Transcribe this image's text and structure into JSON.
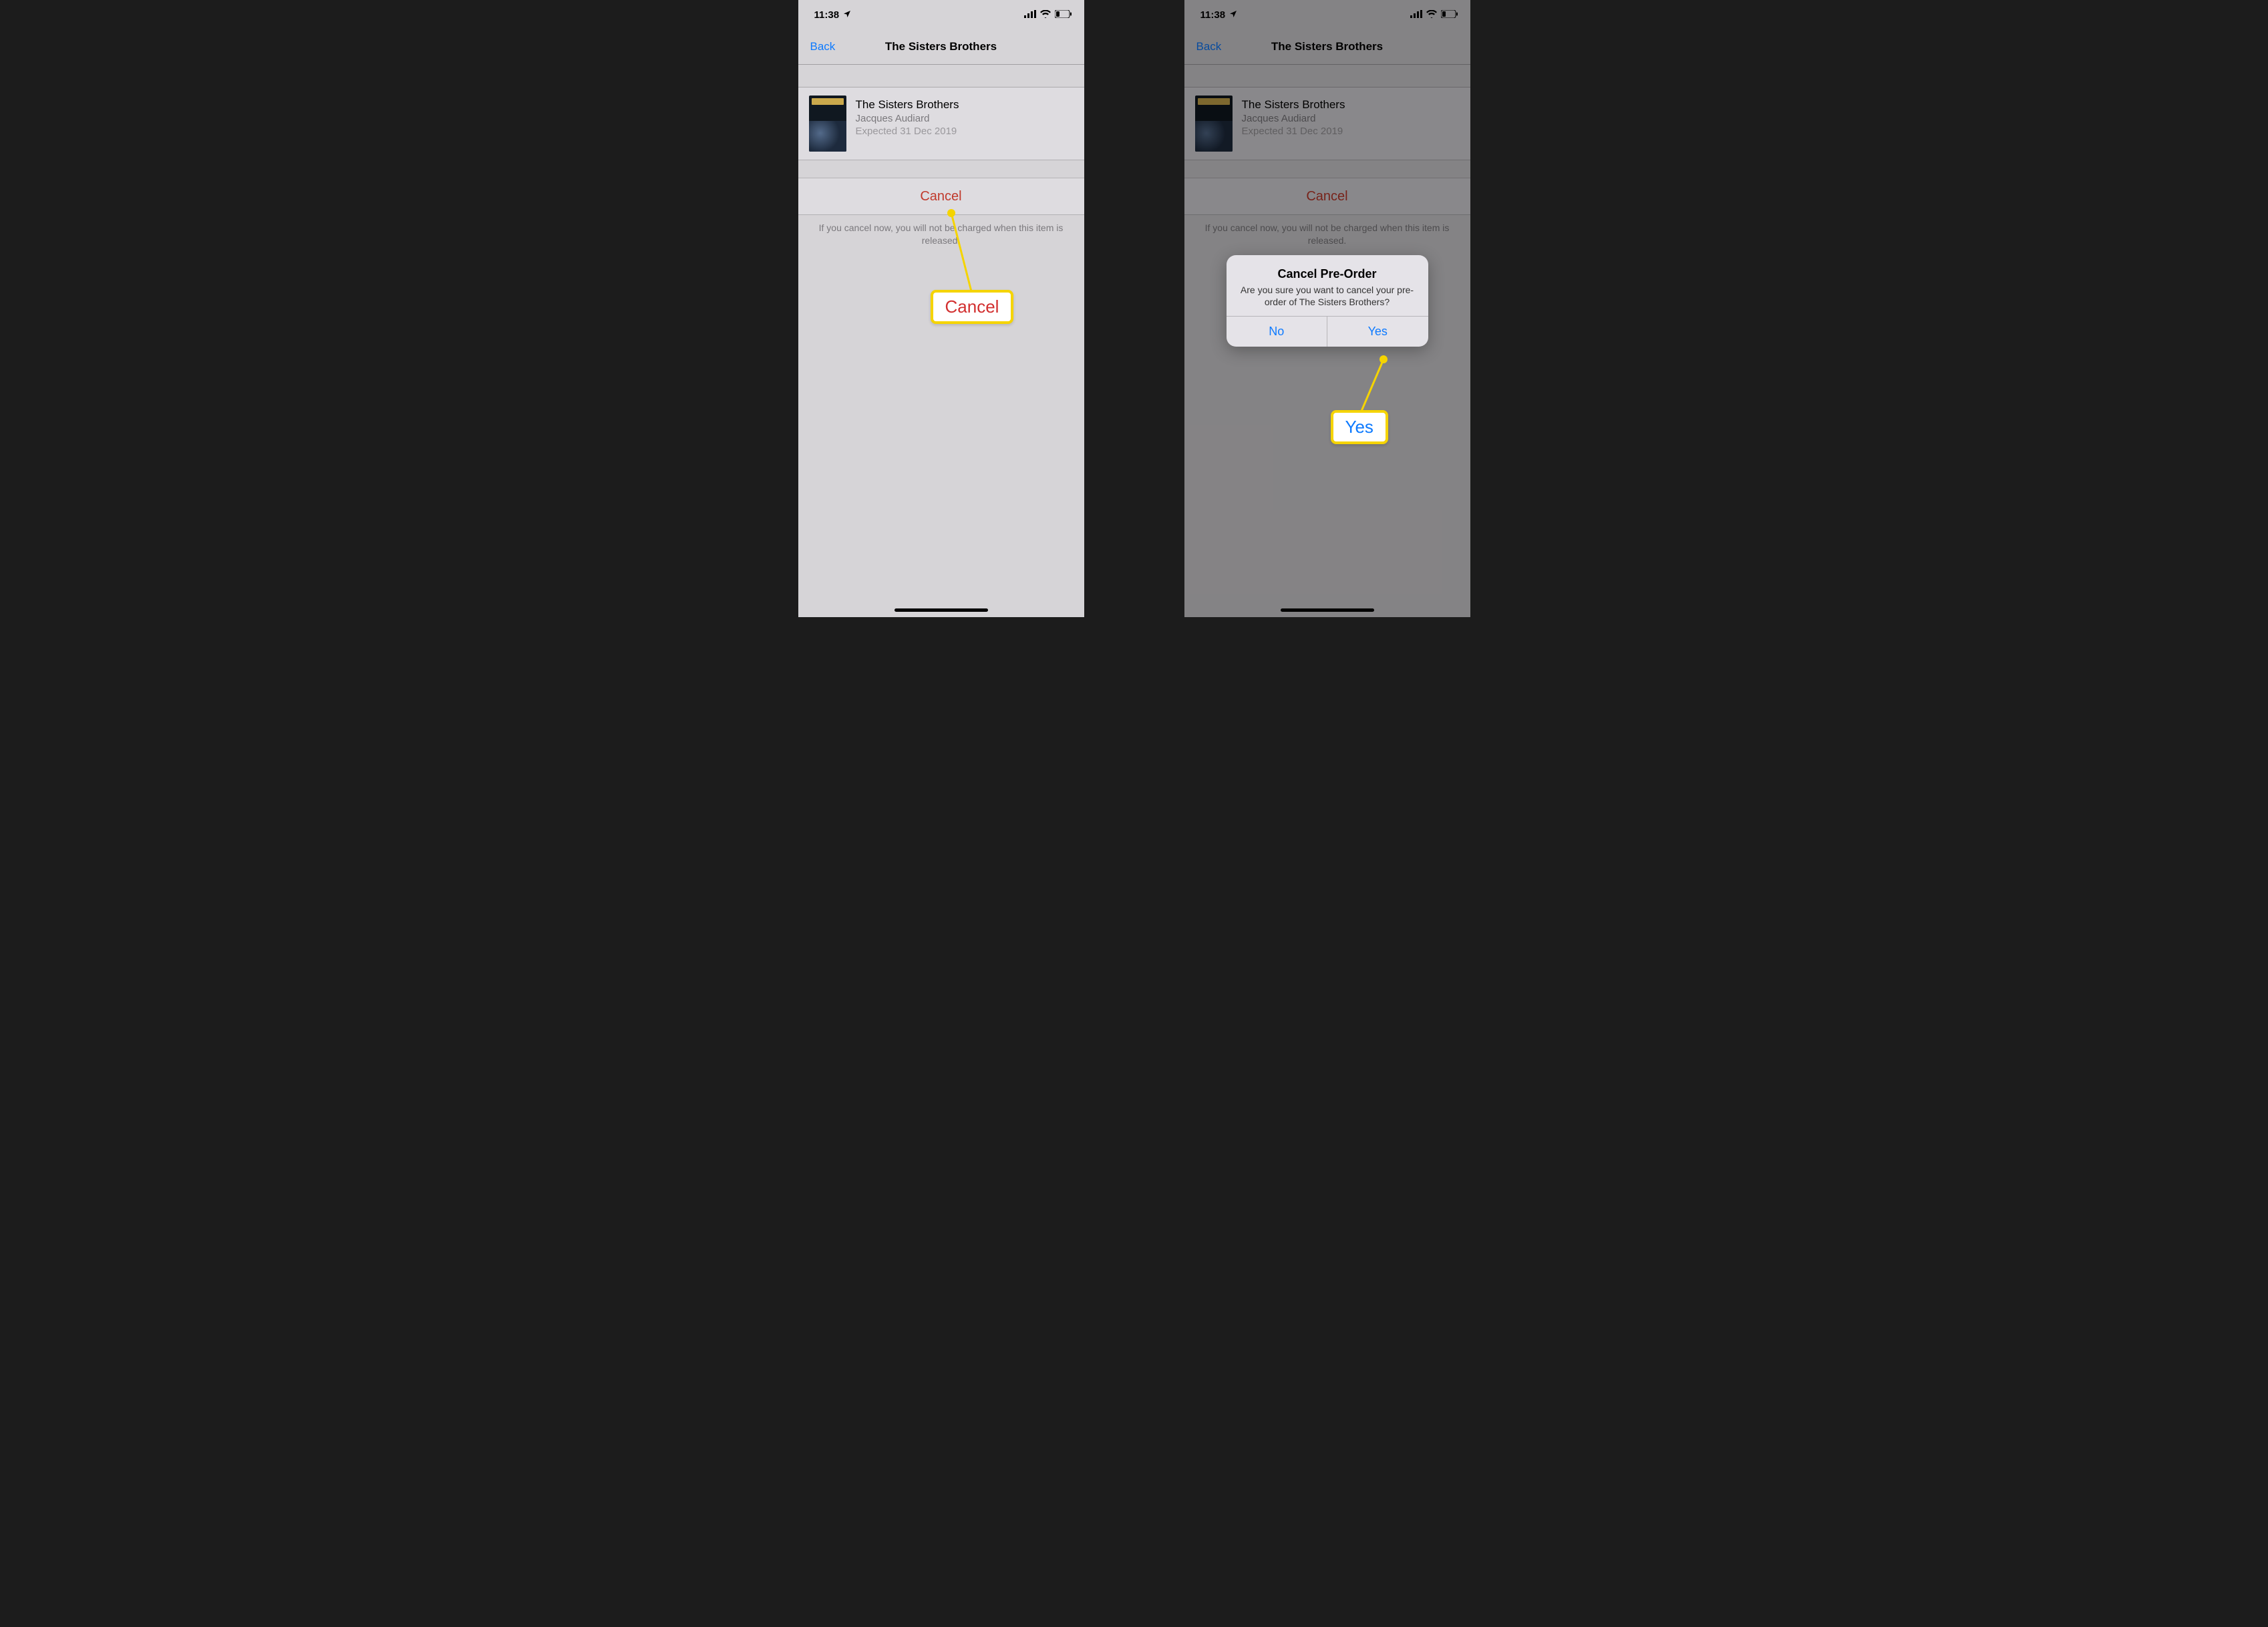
{
  "status": {
    "time": "11:38",
    "location_arrow": "➤"
  },
  "nav": {
    "back": "Back",
    "title": "The Sisters Brothers"
  },
  "item": {
    "title": "The Sisters Brothers",
    "subtitle": "Jacques Audiard",
    "expected": "Expected 31 Dec 2019"
  },
  "cancel": {
    "button": "Cancel",
    "helper": "If you cancel now, you will not be charged when this item is released."
  },
  "callouts": {
    "cancel": "Cancel",
    "yes": "Yes"
  },
  "alert": {
    "title": "Cancel Pre-Order",
    "message": "Are you sure you want to cancel your pre-order of The Sisters Brothers?",
    "no": "No",
    "yes": "Yes"
  }
}
